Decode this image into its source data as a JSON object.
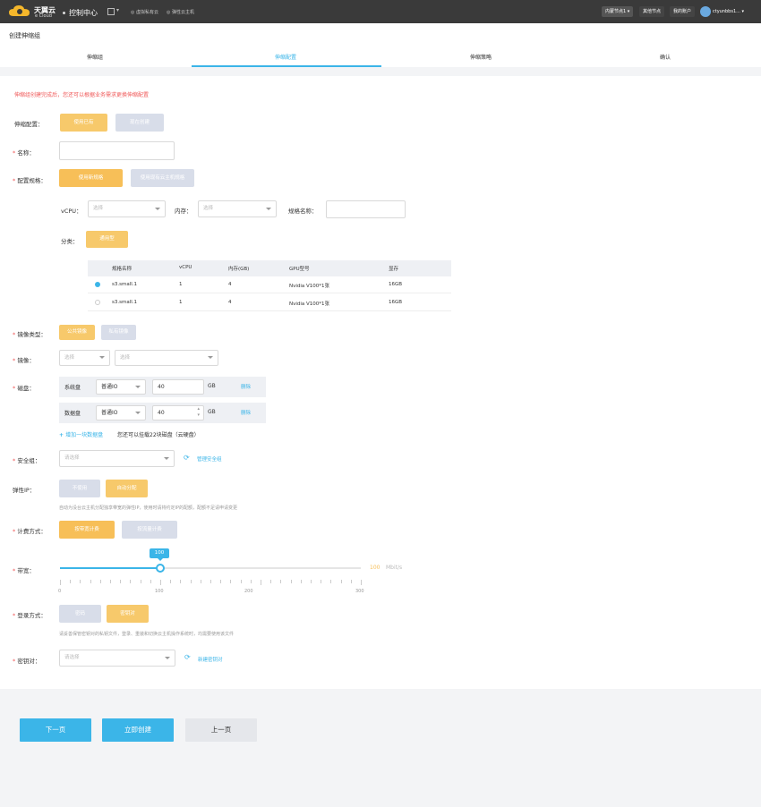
{
  "topbar": {
    "brand": "天翼云",
    "brand_sub": "e Cloud",
    "console": "控制中心",
    "nav_items": [
      "虚拟私有云",
      "弹性云主机"
    ],
    "node_label": "内蒙节点1",
    "other_nodes": "其他节点",
    "account": "我的账户",
    "user": "ctyunbbs1..."
  },
  "page_title": "创建伸缩组",
  "steps": [
    "伸缩组",
    "伸缩配置",
    "伸缩策略",
    "确认"
  ],
  "active_step": 1,
  "notice": "伸缩组创建完成后，您还可以根据业务需求更换伸缩配置",
  "form": {
    "scaling_config": {
      "label": "伸缩配置：",
      "options": [
        "使用已有",
        "现在创建"
      ]
    },
    "name": {
      "label": "名称："
    },
    "spec": {
      "label": "配置规格：",
      "options": [
        "使用新规格",
        "使用现有云主机规格"
      ],
      "vcpu_label": "vCPU：",
      "vcpu_placeholder": "选择",
      "mem_label": "内存：",
      "mem_placeholder": "选择",
      "spec_name_label": "规格名称：",
      "category_label": "分类：",
      "category_value": "通用型"
    },
    "table": {
      "headers": [
        "规格名称",
        "vCPU",
        "内存(GB)",
        "GPU型号",
        "显存"
      ],
      "rows": [
        {
          "name": "s3.small.1",
          "vcpu": "1",
          "mem": "4",
          "gpu": "Nvidia V100*1张",
          "vram": "16GB",
          "selected": true
        },
        {
          "name": "s3.small.1",
          "vcpu": "1",
          "mem": "4",
          "gpu": "Nvidia V100*1张",
          "vram": "16GB",
          "selected": false
        }
      ]
    },
    "image_type": {
      "label": "镜像类型：",
      "options": [
        "公共镜像",
        "私有镜像"
      ]
    },
    "image": {
      "label": "镜像：",
      "placeholder1": "选择",
      "placeholder2": "选择"
    },
    "disk": {
      "label": "磁盘：",
      "system": {
        "label": "系统盘",
        "type": "普通IO",
        "size": "40",
        "unit": "GB",
        "delete": "删除"
      },
      "data": {
        "label": "数据盘",
        "type": "普通IO",
        "size": "40",
        "unit": "GB",
        "delete": "删除"
      },
      "add_link": "增加一块数据盘",
      "add_hint": "您还可以挂载22块磁盘（云硬盘）"
    },
    "security_group": {
      "label": "安全组：",
      "placeholder": "请选择",
      "manage": "管理安全组"
    },
    "eip": {
      "label": "弹性IP：",
      "options": [
        "不使用",
        "自动分配"
      ],
      "hint": "自动为没台云主机分配独享带宽的弹性IP，使用时请将约定IP的配额，配额不足请申请变更"
    },
    "billing": {
      "label": "计费方式：",
      "options": [
        "按带宽计费",
        "按流量计费"
      ]
    },
    "bandwidth": {
      "label": "带宽：",
      "value": "100",
      "unit_value": "100",
      "unit": "Mbit/s",
      "max": 300,
      "ticks": [
        "0",
        "100",
        "200",
        "300"
      ]
    },
    "login": {
      "label": "登录方式：",
      "options": [
        "密码",
        "密钥对"
      ],
      "hint": "请妥善保管密钥对的私钥文件，登录、重装和切换云主机操作系统时，均需要使用该文件"
    },
    "keypair": {
      "label": "密钥对：",
      "placeholder": "请选择",
      "new": "新建密钥对"
    }
  },
  "footer": {
    "next": "下一页",
    "create": "立即创建",
    "prev": "上一页"
  },
  "colors": {
    "accent": "#3bb5e8",
    "yellow": "#f7c96b",
    "red": "#f05a5a"
  }
}
